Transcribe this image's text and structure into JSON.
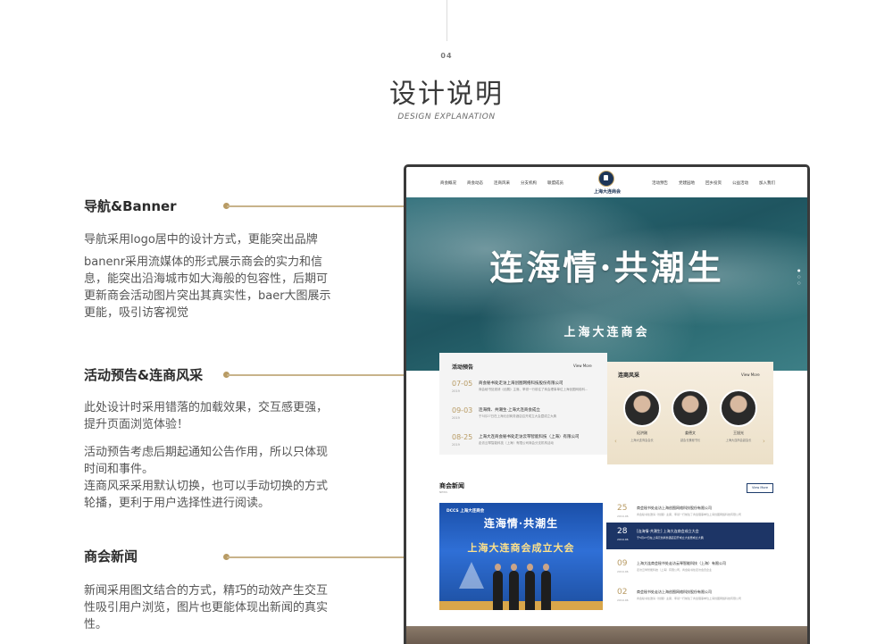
{
  "header": {
    "section_number": "04",
    "title": "设计说明",
    "subtitle": "DESIGN EXPLANATION"
  },
  "features": [
    {
      "title": "导航&Banner",
      "paragraphs": [
        "导航采用logo居中的设计方式，更能突出品牌",
        "banenr采用流媒体的形式展示商会的实力和信息，能突出沿海城市如大海般的包容性，后期可更新商会活动图片突出其真实性，baer大图展示更能，吸引访客视觉"
      ]
    },
    {
      "title": "活动预告&连商风采",
      "paragraphs": [
        "此处设计时采用错落的加载效果，交互感更强，提升页面浏览体验！",
        "活动预告考虑后期起通知公告作用，所以只体现时间和事件。",
        "连商风采采用默认切换，也可以手动切换的方式轮播，更利于用户选择性进行阅读。"
      ]
    },
    {
      "title": "商会新闻",
      "paragraphs": [
        "新闻采用图文结合的方式，精巧的动效产生交互性吸引用户浏览，图片也更能体现出新闻的真实性。"
      ]
    }
  ],
  "site": {
    "nav_left": [
      "商会概况",
      "商会动态",
      "连商风采",
      "分支机构",
      "联盟成员"
    ],
    "nav_right": [
      "活动预告",
      "党建园地",
      "回乡投资",
      "公益活动",
      "加入我们"
    ],
    "logo_text": "上海大连商会",
    "banner": {
      "title": "连海情·共潮生",
      "subtitle": "上海大连商会"
    },
    "activity": {
      "title": "活动预告",
      "more": "View More",
      "items": [
        {
          "date": "07-05",
          "year": "2019",
          "title": "商会秘书处走访上海创图网络科技股份有限公司",
          "desc": "商会秘书处邀请《创展》主席、率领一行前往了商会理事单位上海创图网络科..."
        },
        {
          "date": "09-03",
          "year": "2019",
          "title": "连海情、共潮生·上海大连商会成立",
          "desc": "于5月27日在上海元创商务酒店召开成立大会暨成立大典"
        },
        {
          "date": "08-25",
          "year": "2019",
          "title": "上海大连商会秘书处走访云琴智能科技（上海）有限公司",
          "desc": "走访云琴智能科技（上海）有限公司商会分支机构活动"
        }
      ]
    },
    "members": {
      "title": "连商风采",
      "more": "View More",
      "items": [
        {
          "name": "纪洪刚",
          "role": "上海大连商会会长"
        },
        {
          "name": "姜德文",
          "role": "副会长兼秘书长"
        },
        {
          "name": "王旭光",
          "role": "上海大连商会副会长"
        }
      ]
    },
    "news": {
      "title": "商会新闻",
      "title_en": "NEWS",
      "view_more": "View More",
      "image_tag": "DCCS 上海大连商会",
      "image_title": "连海情·共潮生",
      "image_subtitle": "上海大连商会成立大会",
      "items": [
        {
          "day": "25",
          "ym": "2019-06",
          "title": "商会秘书处走访上海创图网络科技股份有限公司",
          "desc": "商会秘书处邀请《创展》主席、率领一行前往了商会理事单位上海创图网络科技有限公司"
        },
        {
          "day": "28",
          "ym": "2019-06",
          "title": "[连海情·共潮生] 上海大连商会成立大会",
          "desc": "于5月27日在上海元创商务酒店召开成立大会暨成立大典"
        },
        {
          "day": "09",
          "ym": "2019-06",
          "title": "上海大连商会秘书处走访云琴智能科技（上海）有限公司",
          "desc": "走访云琴智能科技（上海）有限公司，商会秘书处走访会员企业"
        },
        {
          "day": "02",
          "ym": "2019-06",
          "title": "商会秘书处走访上海创图网络科技股份有限公司",
          "desc": "商会秘书处邀请《创展》主席、率领一行前往了商会理事单位上海创图网络科技有限公司"
        }
      ]
    }
  },
  "colors": {
    "accent_gold": "#b89b64",
    "navy": "#1d3566",
    "banner_sea": "#1f5560"
  }
}
